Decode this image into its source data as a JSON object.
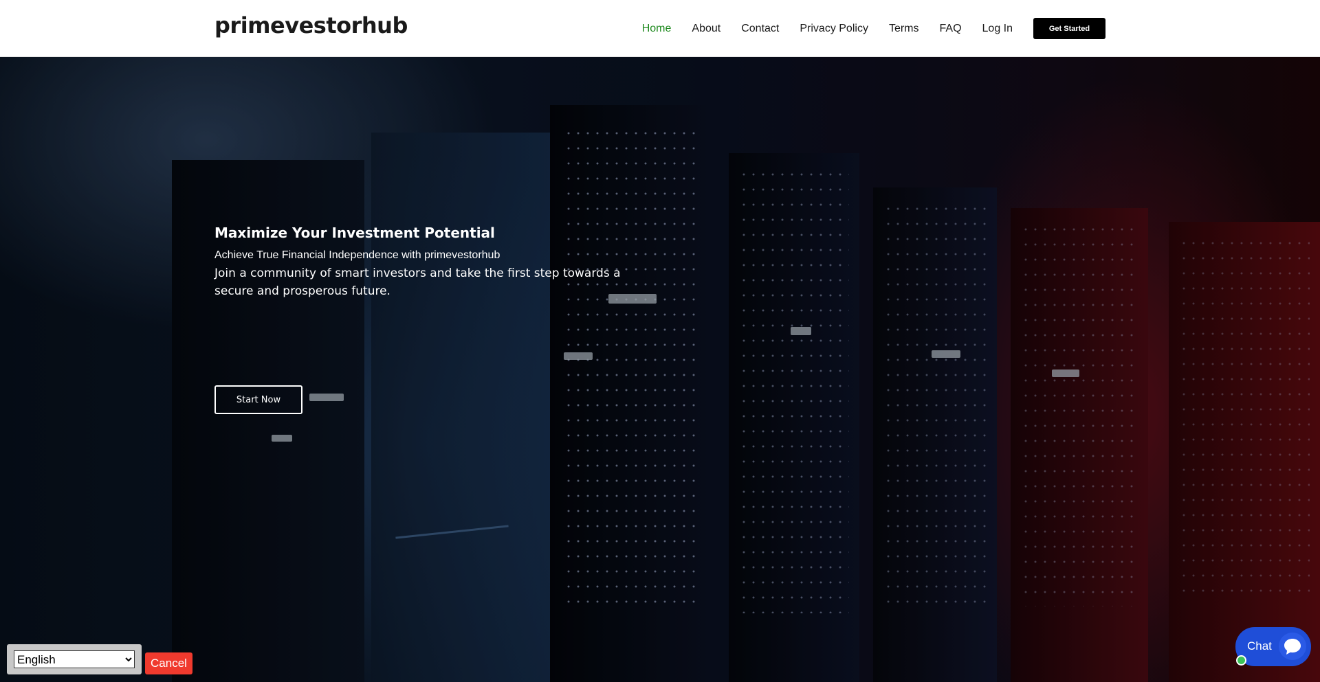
{
  "header": {
    "logo": "primevestorhub",
    "nav": [
      {
        "label": "Home",
        "active": true
      },
      {
        "label": "About"
      },
      {
        "label": "Contact"
      },
      {
        "label": "Privacy Policy"
      },
      {
        "label": "Terms"
      },
      {
        "label": "FAQ"
      },
      {
        "label": "Log In"
      }
    ],
    "cta_label": "Get Started",
    "active_color": "#1f8a1f"
  },
  "hero": {
    "title": "Maximize Your Investment Potential",
    "subtitle": "Achieve True Financial Independence with primevestorhub",
    "text": "Join a community of smart investors and take the first step towards a secure and prosperous future.",
    "button_label": "Start Now",
    "background": "server-room-photo"
  },
  "language": {
    "selected": "English",
    "cancel_label": "Cancel",
    "cancel_color": "#f03a2e"
  },
  "chat": {
    "label": "Chat",
    "icon": "chat-bubble-icon",
    "color": "#1f4ed8",
    "status_color": "#3cc45a"
  }
}
